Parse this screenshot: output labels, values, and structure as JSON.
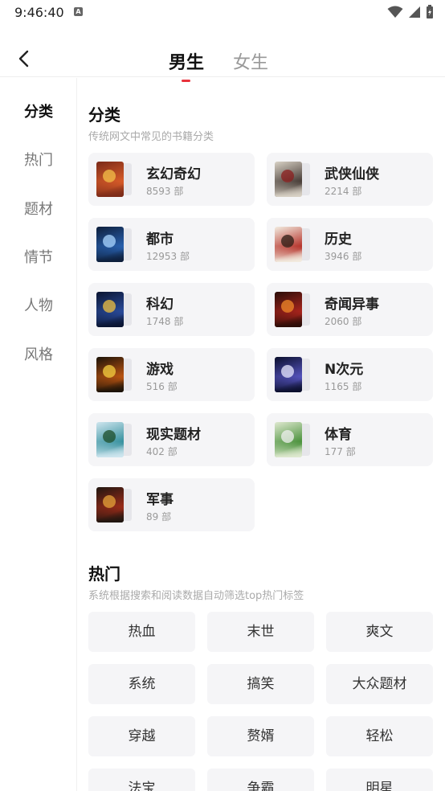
{
  "status": {
    "time": "9:46:40",
    "notif": "A"
  },
  "header": {
    "tabs": [
      {
        "label": "男生",
        "active": true
      },
      {
        "label": "女生",
        "active": false
      }
    ]
  },
  "sidebar": {
    "items": [
      "分类",
      "热门",
      "题材",
      "情节",
      "人物",
      "风格"
    ]
  },
  "categories": {
    "title": "分类",
    "subtitle": "传统网文中常见的书籍分类",
    "items": [
      {
        "name": "玄幻奇幻",
        "count": "8593 部",
        "cover": [
          "#7a2a18",
          "#e0602a",
          "#f3c04a"
        ]
      },
      {
        "name": "武侠仙侠",
        "count": "2214 部",
        "cover": [
          "#d9d2c6",
          "#3a2f2a",
          "#8b1e1e"
        ]
      },
      {
        "name": "都市",
        "count": "12953 部",
        "cover": [
          "#0d1e3a",
          "#2a66b8",
          "#a9d6ff"
        ]
      },
      {
        "name": "历史",
        "count": "3946 部",
        "cover": [
          "#f2ece0",
          "#b1241c",
          "#2b1c14"
        ]
      },
      {
        "name": "科幻",
        "count": "1748 部",
        "cover": [
          "#0a1430",
          "#2c4fa3",
          "#f0c040"
        ]
      },
      {
        "name": "奇闻异事",
        "count": "2060 部",
        "cover": [
          "#2a0d08",
          "#b3261e",
          "#f08a2a"
        ]
      },
      {
        "name": "游戏",
        "count": "516 部",
        "cover": [
          "#1a1208",
          "#c85a12",
          "#f5d040"
        ]
      },
      {
        "name": "N次元",
        "count": "1165 部",
        "cover": [
          "#0b0f2c",
          "#5a58c8",
          "#e8e8ff"
        ]
      },
      {
        "name": "现实题材",
        "count": "402 部",
        "cover": [
          "#cfe6ef",
          "#2a8a98",
          "#1d4e2a"
        ]
      },
      {
        "name": "体育",
        "count": "177 部",
        "cover": [
          "#dfe9d0",
          "#3d8a2f",
          "#f0f0f0"
        ]
      },
      {
        "name": "军事",
        "count": "89 部",
        "cover": [
          "#1f1610",
          "#a52d1a",
          "#e6a33a"
        ]
      }
    ]
  },
  "popular": {
    "title": "热门",
    "subtitle": "系统根据搜索和阅读数据自动筛选top热门标签",
    "tags": [
      "热血",
      "末世",
      "爽文",
      "系统",
      "搞笑",
      "大众题材",
      "穿越",
      "赘婿",
      "轻松",
      "法宝",
      "争霸",
      "明星"
    ]
  }
}
